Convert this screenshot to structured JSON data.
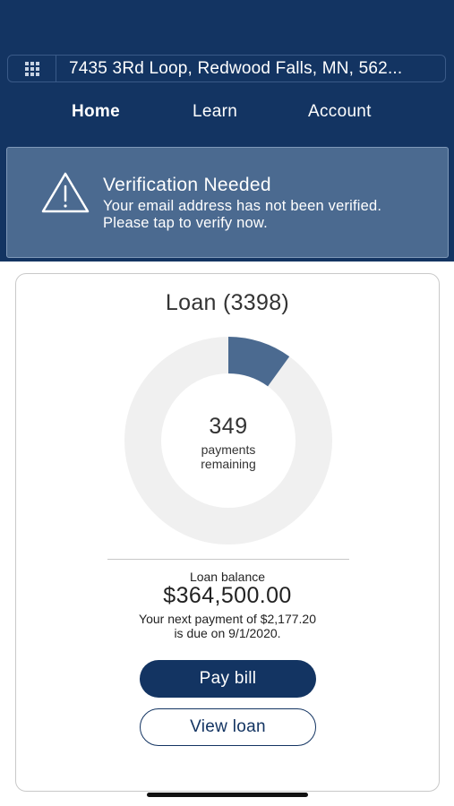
{
  "header": {
    "address": "7435 3Rd Loop, Redwood Falls, MN, 562...",
    "grid_icon": "apps-grid-icon"
  },
  "nav": {
    "tabs": [
      {
        "label": "Home",
        "active": true
      },
      {
        "label": "Learn",
        "active": false
      },
      {
        "label": "Account",
        "active": false
      }
    ]
  },
  "banner": {
    "icon": "warning-icon",
    "title": "Verification Needed",
    "message": "Your email address has not been verified. Please tap to verify now."
  },
  "loan": {
    "title": "Loan (3398)",
    "payments_remaining": "349",
    "payments_remaining_label_line1": "payments",
    "payments_remaining_label_line2": "remaining",
    "progress_fraction_paid": 0.1,
    "balance_label": "Loan balance",
    "balance_value": "$364,500.00",
    "next_payment_line1": "Your next payment of $2,177.20",
    "next_payment_line2": "is due on 9/1/2020.",
    "pay_button": "Pay bill",
    "view_button": "View loan"
  },
  "colors": {
    "primary": "#133462",
    "banner_bg": "#4b6a90",
    "donut_track": "#f0f0f0",
    "donut_fill": "#4b6a90"
  }
}
